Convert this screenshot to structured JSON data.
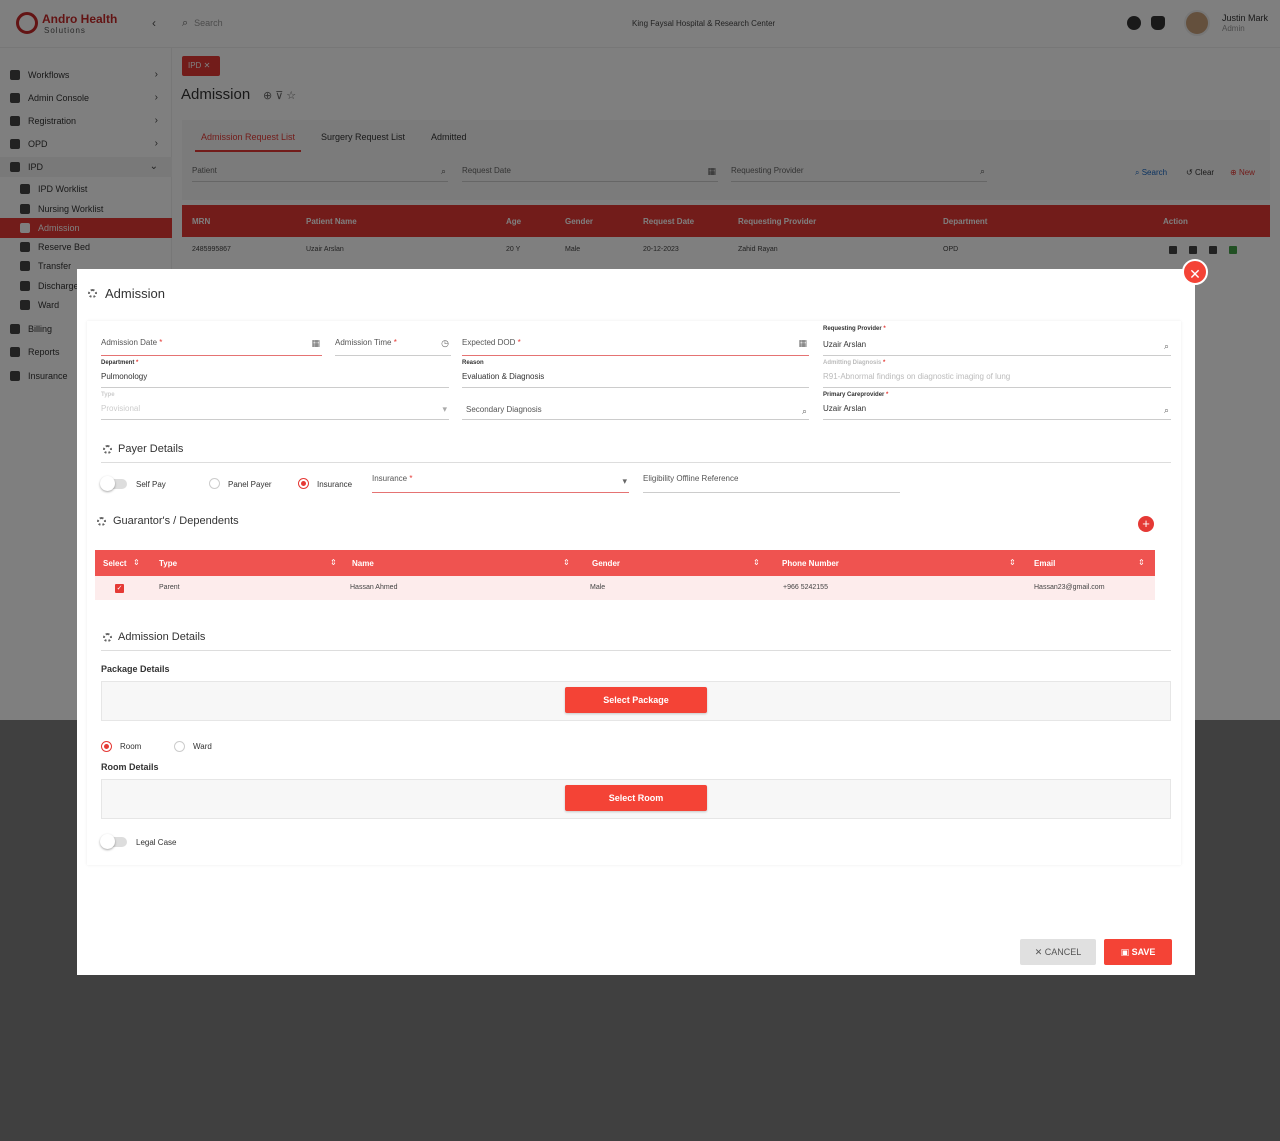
{
  "brand": {
    "name": "Andro Health",
    "tagline": "Solutions"
  },
  "header": {
    "search_placeholder": "Search",
    "hospital": "King Faysal Hospital & Research Center",
    "user_name": "Justin Mark",
    "user_role": "Admin"
  },
  "sidebar": {
    "workflows": "Workflows",
    "admin_console": "Admin Console",
    "registration": "Registration",
    "opd": "OPD",
    "ipd": "IPD",
    "ipd_worklist": "IPD Worklist",
    "nursing_worklist": "Nursing Worklist",
    "admission": "Admission",
    "reserve_bed": "Reserve Bed",
    "transfer": "Transfer",
    "discharge": "Discharge",
    "ward": "Ward",
    "billing": "Billing",
    "reports": "Reports",
    "insurance": "Insurance"
  },
  "page": {
    "chip": "IPD",
    "title": "Admission",
    "tabs": [
      "Admission Request List",
      "Surgery Request List",
      "Admitted"
    ],
    "filters": {
      "patient": "Patient",
      "request_date": "Request Date",
      "requesting_provider": "Requesting Provider"
    },
    "actions": {
      "search": "Search",
      "clear": "Clear",
      "new": "New"
    },
    "grid_headers": [
      "MRN",
      "Patient Name",
      "Age",
      "Gender",
      "Request Date",
      "Requesting Provider",
      "Department",
      "Action"
    ],
    "grid_row": {
      "mrn": "2485995867",
      "name": "Uzair Arslan",
      "age": "20 Y",
      "gender": "Male",
      "date": "20-12-2023",
      "provider": "Zahid Rayan",
      "dept": "OPD"
    }
  },
  "modal": {
    "title": "Admission",
    "fields": {
      "admission_date": "Admission Date",
      "admission_time": "Admission Time",
      "expected_dod": "Expected DOD",
      "requesting_provider_label": "Requesting Provider",
      "requesting_provider_value": "Uzair Arslan",
      "department_label": "Department",
      "department_value": "Pulmonology",
      "reason_label": "Reason",
      "reason_value": "Evaluation & Diagnosis",
      "admitting_diagnosis_label": "Admitting Diagnosis",
      "admitting_diagnosis_value": "R91-Abnormal findings on diagnostic imaging of lung",
      "type_label": "Type",
      "type_value": "Provisional",
      "secondary_diagnosis": "Secondary Diagnosis",
      "primary_careprovider_label": "Primary Careprovider",
      "primary_careprovider_value": "Uzair Arslan"
    },
    "payer": {
      "title": "Payer Details",
      "self_pay": "Self Pay",
      "panel_payer": "Panel Payer",
      "insurance": "Insurance",
      "insurance_field": "Insurance",
      "eligibility": "Eligibility Offline Reference"
    },
    "guarantor": {
      "title": "Guarantor's / Dependents",
      "headers": [
        "Select",
        "Type",
        "Name",
        "Gender",
        "Phone Number",
        "Email"
      ],
      "row": {
        "type": "Parent",
        "name": "Hassan Ahmed",
        "gender": "Male",
        "phone": "+966 5242155",
        "email": "Hassan23@gmail.com"
      }
    },
    "admission_details": {
      "title": "Admission Details",
      "package_details": "Package Details",
      "select_package": "Select Package",
      "room": "Room",
      "ward": "Ward",
      "room_details": "Room Details",
      "select_room": "Select Room",
      "legal_case": "Legal Case"
    },
    "buttons": {
      "cancel": "CANCEL",
      "save": "SAVE"
    }
  },
  "colors": {
    "accent": "#e53935",
    "header_red": "#ef5350"
  }
}
